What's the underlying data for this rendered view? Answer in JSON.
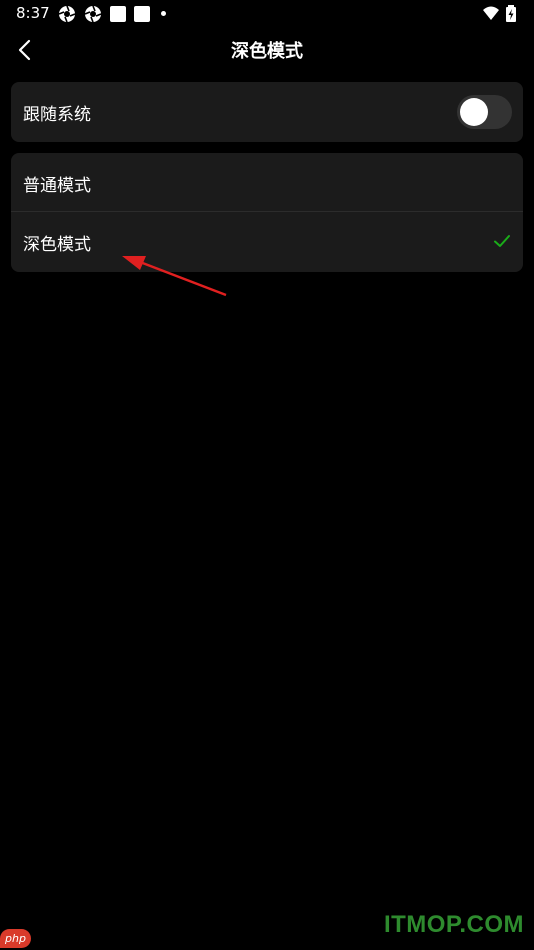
{
  "status_bar": {
    "time": "8:37",
    "icons": [
      "aperture-icon",
      "aperture-icon",
      "square-icon",
      "square-icon",
      "dot-icon",
      "wifi-icon",
      "battery-charging-icon"
    ]
  },
  "header": {
    "title": "深色模式",
    "back_icon": "chevron-left-icon"
  },
  "follow_system": {
    "label": "跟随系统",
    "enabled": false
  },
  "modes": [
    {
      "label": "普通模式",
      "selected": false
    },
    {
      "label": "深色模式",
      "selected": true
    }
  ],
  "colors": {
    "background": "#000000",
    "card": "#1b1b1b",
    "toggle_off": "#333333",
    "check": "#1aad19",
    "annotation_arrow": "#e02020"
  },
  "watermarks": {
    "badge": "php",
    "site": "ITMOP.COM"
  }
}
